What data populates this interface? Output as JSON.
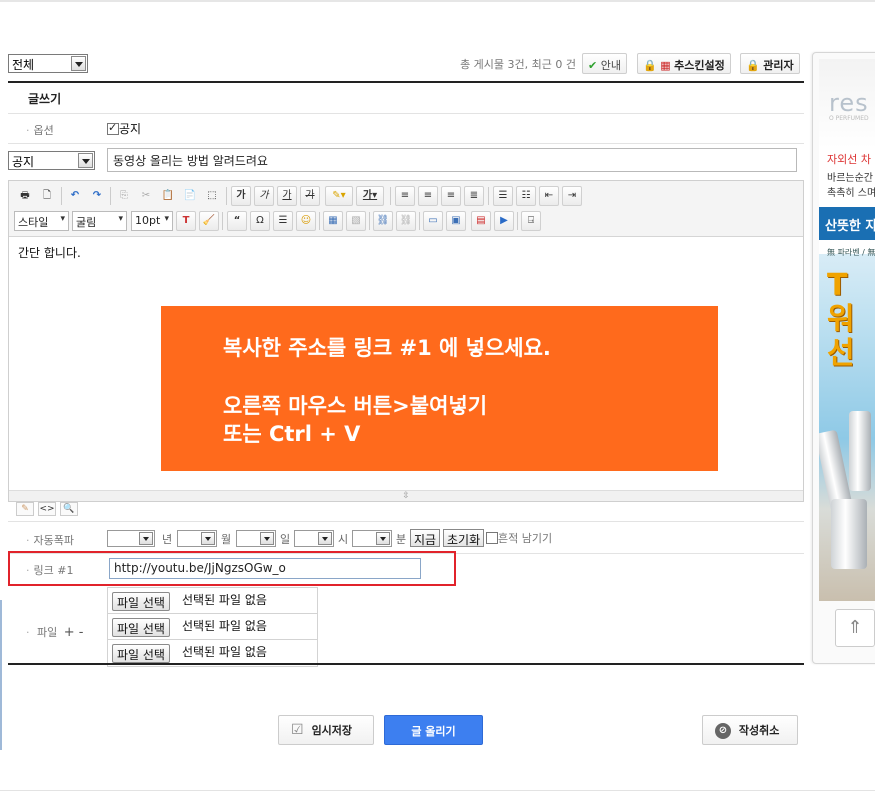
{
  "board": {
    "category_filter": "전체",
    "post_count": "총 게시물 3건, 최근 0 건",
    "btn_help": "안내",
    "btn_skin": "추스킨설정",
    "btn_admin": "관리자"
  },
  "form": {
    "section_title": "글쓰기",
    "option_label": "옵션",
    "notice_checkbox": "공지",
    "category_value": "공지",
    "subject_value": "동영상 올리는 방법 알려드려요",
    "autopost_label": "자동폭파",
    "unit_year": "년",
    "unit_month": "월",
    "unit_day": "일",
    "unit_hour": "시",
    "unit_min": "분",
    "btn_now": "지금",
    "btn_reset": "초기화",
    "leave_trace": "흔적 남기기",
    "link_label": "링크 #1",
    "link_value": "http://youtu.be/JjNgzsOGw_o",
    "file_label": "파일",
    "file_plusminus": "+ -",
    "file_btn": "파일 선택",
    "file_none": "선택된 파일 없음"
  },
  "editor": {
    "style_select": "스타일",
    "font_select": "굴림",
    "size_select": "10pt",
    "body_text": "간단 합니다.",
    "banner_line1": "복사한 주소를 링크 #1 에 넣으세요.",
    "banner_line2": "오른쪽 마우스 버튼>붙여넣기",
    "banner_line3": "또는 Ctrl + V"
  },
  "actions": {
    "temp_save": "임시저장",
    "submit": "글 올리기",
    "cancel": "작성취소"
  },
  "ad": {
    "logo": "res",
    "sub": "O PERFUMED",
    "red_line": "자외선 차",
    "line1": "바르는순간",
    "line2": "촉촉히 스며",
    "band": "산뜻한 자",
    "small": "無 파라벤 / 無",
    "big1": "T",
    "big2": "워",
    "big3": "선"
  },
  "colors": {
    "accent": "#3d7ff0",
    "banner": "#ff6a1c",
    "highlight": "#e1232b"
  }
}
